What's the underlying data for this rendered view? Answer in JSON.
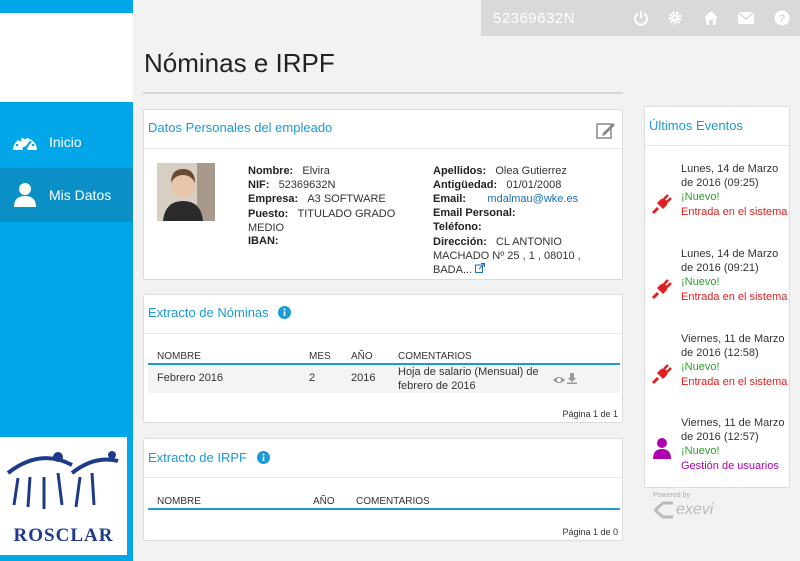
{
  "header": {
    "nif": "52369632N"
  },
  "sidebar": {
    "items": [
      {
        "label": "Inicio",
        "icon": "dashboard-icon"
      },
      {
        "label": "Mis Datos",
        "icon": "user-icon"
      }
    ],
    "logo_text": "ROSCLAR"
  },
  "page": {
    "title": "Nóminas e IRPF"
  },
  "personal": {
    "title": "Datos Personales del empleado",
    "nombre_label": "Nombre:",
    "nombre": "Elvira",
    "nif_label": "NIF:",
    "nif": "52369632N",
    "empresa_label": "Empresa:",
    "empresa": "A3 SOFTWARE",
    "puesto_label": "Puesto:",
    "puesto": "TITULADO GRADO MEDIO",
    "iban_label": "IBAN:",
    "apellidos_label": "Apellidos:",
    "apellidos": "Olea Gutierrez",
    "antiguedad_label": "Antigüedad:",
    "antiguedad": "01/01/2008",
    "email_label": "Email:",
    "email": "mdalmau@wke.es",
    "email_personal_label": "Email Personal:",
    "telefono_label": "Teléfono:",
    "direccion_label": "Dirección:",
    "direccion": "CL ANTONIO MACHADO Nº 25 , 1 , 08010 , BADA..."
  },
  "nominas": {
    "title": "Extracto de Nóminas",
    "headers": [
      "NOMBRE",
      "MES",
      "AÑO",
      "COMENTARIOS"
    ],
    "rows": [
      {
        "nombre": "Febrero 2016",
        "mes": "2",
        "anio": "2016",
        "comentarios": "Hoja de salario (Mensual) de febrero de 2016"
      }
    ],
    "pager": "Página 1 de 1"
  },
  "irpf": {
    "title": "Extracto de IRPF",
    "headers": [
      "NOMBRE",
      "AÑO",
      "COMENTARIOS"
    ],
    "pager": "Página 1 de 0"
  },
  "events": {
    "title": "Últimos Eventos",
    "items": [
      {
        "date": "Lunes, 14 de Marzo de 2016 (09:25)",
        "new": "¡Nuevo!",
        "desc": "Entrada en el sistema"
      },
      {
        "date": "Lunes, 14 de Marzo de 2016 (09:21)",
        "new": "¡Nuevo!",
        "desc": "Entrada en el sistema"
      },
      {
        "date": "Viernes, 11 de Marzo de 2016 (12:58)",
        "new": "¡Nuevo!",
        "desc": "Entrada en el sistema"
      },
      {
        "date": "Viernes, 11 de Marzo de 2016 (12:57)",
        "new": "¡Nuevo!",
        "desc": "Gestión de usuarios"
      }
    ]
  },
  "footer": {
    "powered": "Powered by",
    "brand": "exevi"
  },
  "colors": {
    "accent": "#01a6e8",
    "link": "#1a9ad6",
    "new": "#2ca02c",
    "event_red": "#e02020",
    "event_purple": "#b000b0"
  }
}
